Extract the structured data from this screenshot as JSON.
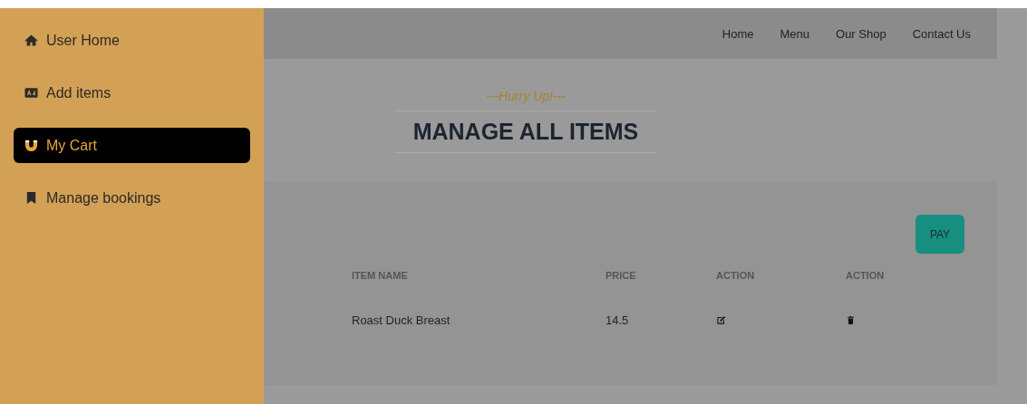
{
  "sidebar": {
    "items": [
      {
        "label": "User Home",
        "selected": false
      },
      {
        "label": "Add items",
        "selected": false
      },
      {
        "label": "My Cart",
        "selected": true
      },
      {
        "label": "Manage bookings",
        "selected": false
      }
    ]
  },
  "nav": [
    "Home",
    "Menu",
    "Our Shop",
    "Contact Us"
  ],
  "subtitle": "---Hurry Up!---",
  "title": "MANAGE ALL ITEMS",
  "pay_button": "PAY",
  "table": {
    "columns": [
      "ITEM NAME",
      "PRICE",
      "ACTION",
      "ACTION"
    ],
    "rows": [
      {
        "name": "Roast Duck Breast",
        "price": "14.5"
      }
    ]
  }
}
